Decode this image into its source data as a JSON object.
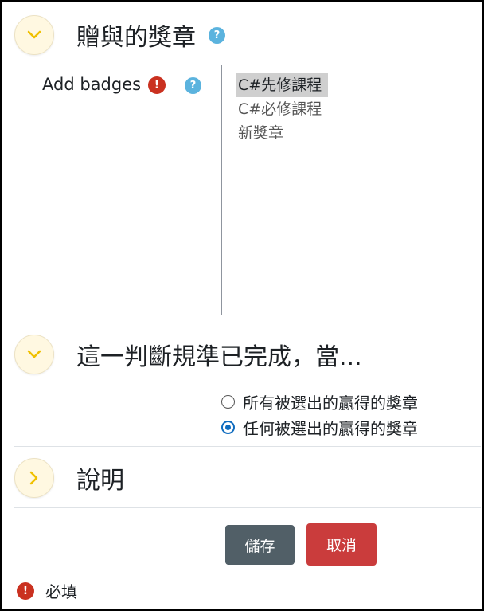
{
  "sections": {
    "badges": {
      "title": "贈與的獎章",
      "field_label": "Add badges",
      "options": [
        "C#先修課程",
        "C#必修課程",
        "新獎章"
      ],
      "selected_option": "C#先修課程"
    },
    "condition": {
      "title": "這一判斷規準已完成，當...",
      "radios": [
        {
          "label": "所有被選出的贏得的獎章",
          "checked": false
        },
        {
          "label": "任何被選出的贏得的獎章",
          "checked": true
        }
      ]
    },
    "description": {
      "title": "說明"
    }
  },
  "buttons": {
    "save": "儲存",
    "cancel": "取消"
  },
  "required_note": "必填",
  "icons": {
    "help": "?",
    "required": "!"
  },
  "colors": {
    "help_icon": "#5bb3de",
    "required_icon": "#ca3120",
    "save_button": "#515f67",
    "cancel_button": "#ca3c3c",
    "radio_selected": "#0f6cbf",
    "chevron": "#f0c000"
  }
}
